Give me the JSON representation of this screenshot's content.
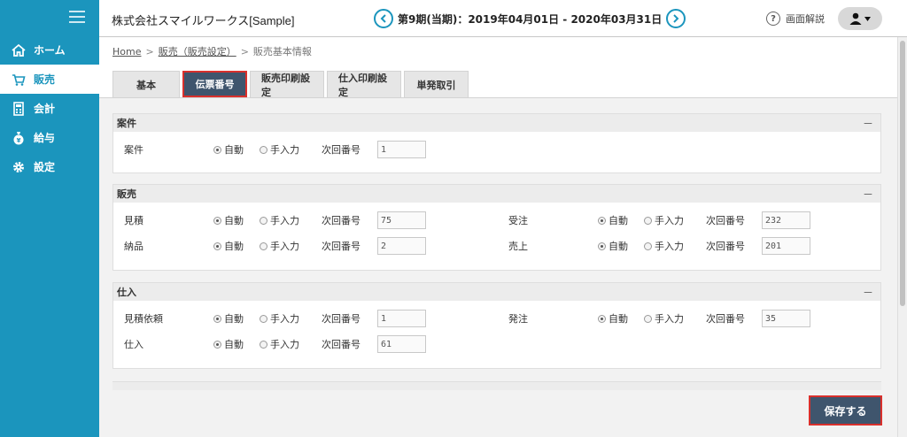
{
  "sidebar": {
    "items": [
      {
        "label": "ホーム",
        "icon": "home-icon",
        "active": false
      },
      {
        "label": "販売",
        "icon": "cart-icon",
        "active": true
      },
      {
        "label": "会計",
        "icon": "calculator-icon",
        "active": false
      },
      {
        "label": "給与",
        "icon": "money-bag-icon",
        "active": false
      },
      {
        "label": "設定",
        "icon": "gear-icon",
        "active": false
      }
    ]
  },
  "header": {
    "company": "株式会社スマイルワークス[Sample]",
    "period": "第9期(当期)：2019年04月01日 - 2020年03月31日",
    "help_label": "画面解説"
  },
  "breadcrumb": {
    "home": "Home",
    "sales_settings": "販売（販売設定）",
    "current": "販売基本情報",
    "sep": ">"
  },
  "tabs": [
    {
      "label": "基本",
      "active": false
    },
    {
      "label": "伝票番号",
      "active": true
    },
    {
      "label": "販売印刷設定",
      "active": false
    },
    {
      "label": "仕入印刷設定",
      "active": false
    },
    {
      "label": "単発取引",
      "active": false
    }
  ],
  "radio": {
    "auto": "自動",
    "manual": "手入力"
  },
  "next_number_label": "次回番号",
  "collapse_symbol": "－",
  "sections": {
    "project": {
      "title": "案件",
      "rows": [
        {
          "label": "案件",
          "value": "1"
        }
      ]
    },
    "sales": {
      "title": "販売",
      "rows": [
        {
          "label": "見積",
          "value": "75"
        },
        {
          "label": "納品",
          "value": "2"
        },
        {
          "label": "受注",
          "value": "232"
        },
        {
          "label": "売上",
          "value": "201"
        }
      ]
    },
    "purchase": {
      "title": "仕入",
      "rows": [
        {
          "label": "見積依頼",
          "value": "1"
        },
        {
          "label": "仕入",
          "value": "61"
        },
        {
          "label": "発注",
          "value": "35"
        }
      ]
    }
  },
  "save_label": "保存する",
  "colors": {
    "sidebar": "#1b95bd",
    "active_tab": "#3f556d",
    "highlight": "#d9302c"
  }
}
